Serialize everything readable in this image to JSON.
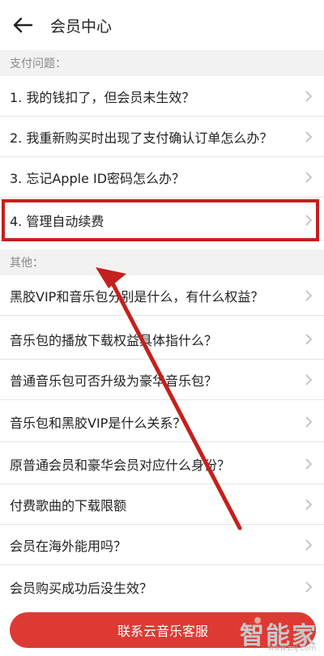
{
  "header": {
    "title": "会员中心"
  },
  "sections": [
    {
      "title": "支付问题："
    },
    {
      "title": "其他："
    }
  ],
  "rows": [
    "1. 我的钱扣了，但会员未生效？",
    "2. 我重新购买时出现了支付确认订单怎么办？",
    "3. 忘记Apple ID密码怎么办？",
    "4. 管理自动续费",
    "黑胶VIP和音乐包分别是什么，有什么权益？",
    "音乐包的播放下载权益具体指什么？",
    "普通音乐包可否升级为豪华音乐包？",
    "音乐包和黑胶VIP是什么关系？",
    "原普通会员和豪华会员对应什么身份？",
    "付费歌曲的下载限额",
    "会员在海外能用吗？",
    "会员购买成功后没生效？"
  ],
  "footer": {
    "button_label": "联系云音乐客服"
  },
  "watermark": {
    "text": "智能家",
    "url": "www.znj.com"
  },
  "icons": {
    "back": "back-arrow-icon",
    "chevron": "chevron-right-icon"
  },
  "colors": {
    "accent": "#dd3a33",
    "highlight": "#c4201e",
    "section_bg": "#f2f2f2"
  }
}
